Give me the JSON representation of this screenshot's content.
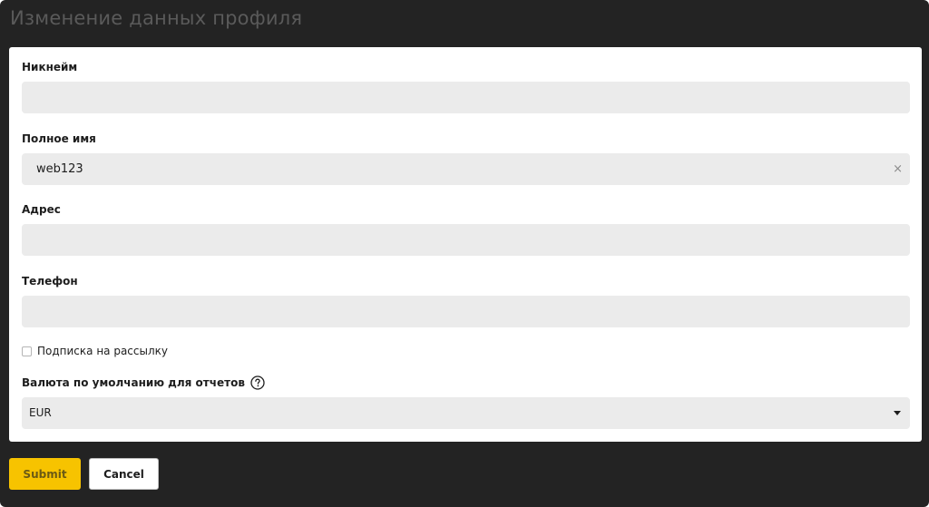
{
  "page": {
    "title": "Изменение данных профиля"
  },
  "form": {
    "nickname": {
      "label": "Никнейм",
      "value": ""
    },
    "full_name": {
      "label": "Полное имя",
      "value": "web123",
      "clear_icon": "×"
    },
    "address": {
      "label": "Адрес",
      "value": ""
    },
    "phone": {
      "label": "Телефон",
      "value": ""
    },
    "newsletter": {
      "label": "Подписка на рассылку",
      "checked": false
    },
    "currency": {
      "label": "Валюта по умолчанию для отчетов",
      "help_icon": "question-circle-icon",
      "selected": "EUR",
      "arrow_icon": "caret-down-icon"
    }
  },
  "actions": {
    "submit_label": "Submit",
    "cancel_label": "Cancel"
  },
  "colors": {
    "background": "#232323",
    "card": "#ffffff",
    "input": "#ebebeb",
    "submit": "#f7c300"
  }
}
